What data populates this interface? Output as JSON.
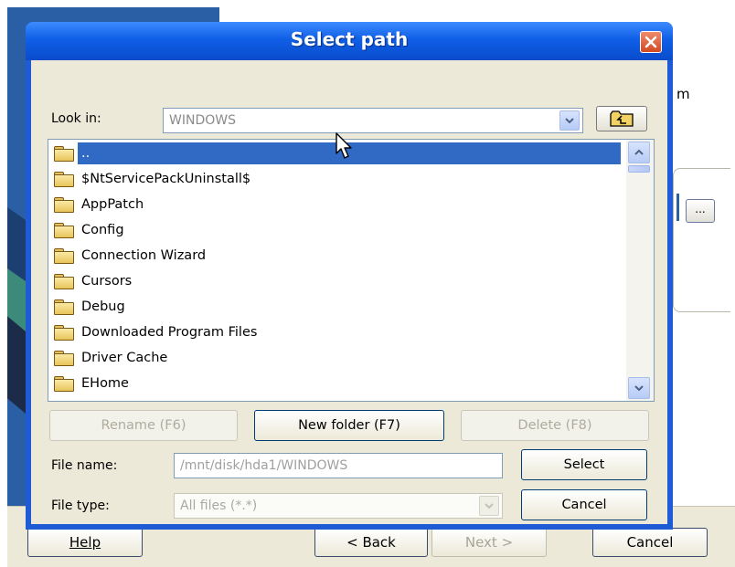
{
  "background": {
    "side_text": "m",
    "browse_button": "...",
    "footer": {
      "help": "Help",
      "back": "< Back",
      "back_accel": "B",
      "next": "Next >",
      "cancel": "Cancel"
    }
  },
  "dialog": {
    "title": "Select path",
    "look_in_label": "Look in:",
    "look_in_value": "WINDOWS",
    "folders": [
      "..",
      "$NtServicePackUninstall$",
      "AppPatch",
      "Config",
      "Connection Wizard",
      "Cursors",
      "Debug",
      "Downloaded Program Files",
      "Driver Cache",
      "EHome"
    ],
    "selected_index": 0,
    "buttons": {
      "rename": "Rename (F6)",
      "new_folder": "New folder (F7)",
      "delete": "Delete (F8)",
      "select": "Select",
      "cancel": "Cancel"
    },
    "file_name_label": "File name:",
    "file_name_value": "/mnt/disk/hda1/WINDOWS",
    "file_type_label": "File type:",
    "file_type_value": "All files (*.*)"
  },
  "colors": {
    "title_bar": "#0a4bcc",
    "selection": "#316ac5",
    "dialog_face": "#ece9d8"
  }
}
